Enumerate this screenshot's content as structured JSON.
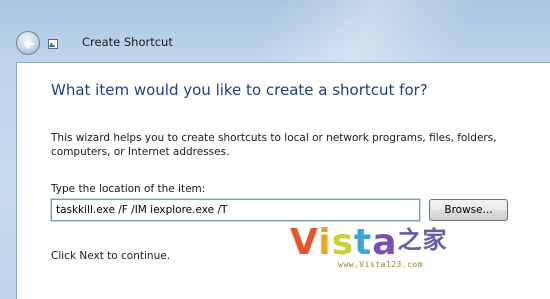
{
  "window": {
    "title": "Create Shortcut"
  },
  "icons": {
    "back": "back-arrow-icon",
    "shortcut": "shortcut-icon"
  },
  "main": {
    "heading": "What item would you like to create a shortcut for?",
    "description": "This wizard helps you to create shortcuts to local or network programs, files, folders, computers, or Internet addresses.",
    "location_label": "Type the location of the item:",
    "location_value": "taskkill.exe /F /IM iexplore.exe /T",
    "browse_label": "Browse...",
    "continue_text": "Click Next to continue."
  },
  "watermark": {
    "text": "Vista之家",
    "url": "www.Vista123.com"
  },
  "colors": {
    "heading": "#1e3e8c",
    "frame": "#bcd3ea"
  }
}
